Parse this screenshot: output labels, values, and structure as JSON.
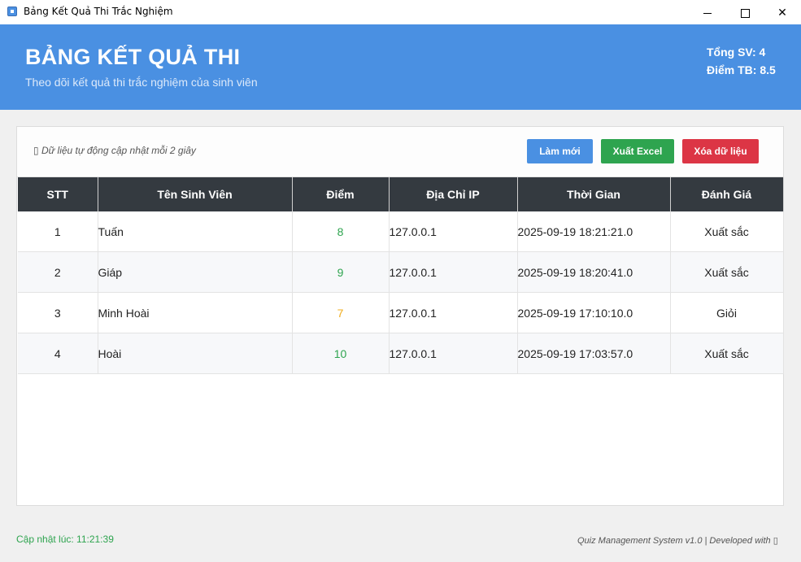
{
  "window": {
    "title": "Bảng Kết Quả Thi Trắc Nghiệm",
    "app_icon": "app-icon",
    "controls": {
      "minimize": "minimize-icon",
      "maximize": "maximize-icon",
      "close": "✕"
    }
  },
  "header": {
    "title": "BẢNG KẾT QUẢ THI",
    "subtitle": "Theo dõi kết quả thi trắc nghiệm của sinh viên",
    "total_students": "Tổng SV: 4",
    "average_score": "Điểm TB: 8.5"
  },
  "toolbar": {
    "auto_update_note": "▯ Dữ liệu tự động cập nhật mỗi 2 giây",
    "refresh_label": "Làm mới",
    "export_label": "Xuất Excel",
    "clear_label": "Xóa dữ liệu"
  },
  "table": {
    "columns": [
      "STT",
      "Tên Sinh Viên",
      "Điểm",
      "Địa Chỉ IP",
      "Thời Gian",
      "Đánh Giá"
    ],
    "rows": [
      {
        "stt": "1",
        "name": "Tuấn",
        "score": "8",
        "ip": "127.0.0.1",
        "time": "2025-09-19 18:21:21.0",
        "rating": "Xuất sắc",
        "score_color": "#2ea44f"
      },
      {
        "stt": "2",
        "name": "Giáp",
        "score": "9",
        "ip": "127.0.0.1",
        "time": "2025-09-19 18:20:41.0",
        "rating": "Xuất sắc",
        "score_color": "#2ea44f"
      },
      {
        "stt": "3",
        "name": "Minh Hoài",
        "score": "7",
        "ip": "127.0.0.1",
        "time": "2025-09-19 17:10:10.0",
        "rating": "Giỏi",
        "score_color": "#f0ad1e"
      },
      {
        "stt": "4",
        "name": "Hoài",
        "score": "10",
        "ip": "127.0.0.1",
        "time": "2025-09-19 17:03:57.0",
        "rating": "Xuất sắc",
        "score_color": "#2ea44f"
      }
    ]
  },
  "footer": {
    "last_updated": "Cập nhật lúc: 11:21:39",
    "credit": "Quiz Management System v1.0 | Developed with ▯"
  },
  "colors": {
    "header_bg": "#4a90e2",
    "table_header_bg": "#343a40",
    "refresh_button": "#4a90e2",
    "export_button": "#2ea44f",
    "clear_button": "#dc3545",
    "footer_status": "#2ea44f"
  }
}
